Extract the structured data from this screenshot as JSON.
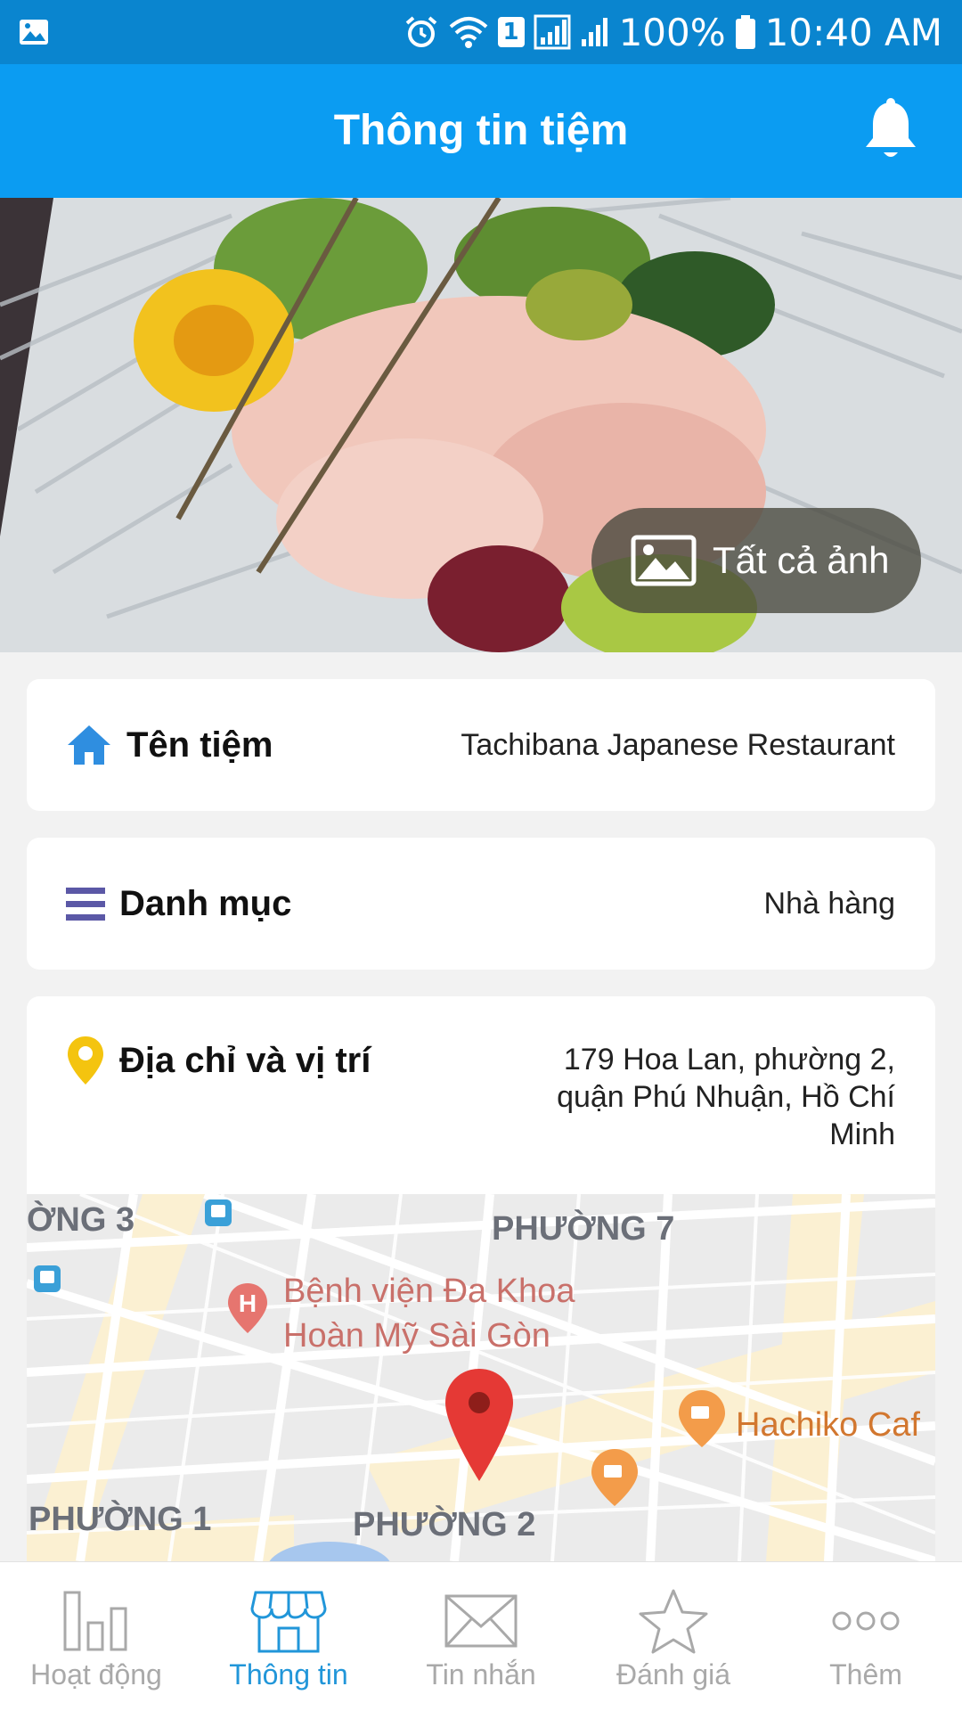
{
  "status_bar": {
    "battery": "100%",
    "time": "10:40 AM",
    "sim_badge": "1"
  },
  "header": {
    "title": "Thông tin tiệm",
    "bell_icon": "bell-icon"
  },
  "hero": {
    "all_photos_label": "Tất cả ảnh"
  },
  "info": {
    "name_label": "Tên tiệm",
    "name_value": "Tachibana Japanese Restaurant",
    "category_label": "Danh mục",
    "category_value": "Nhà hàng",
    "address_label": "Địa chỉ và vị trí",
    "address_lines": [
      "179 Hoa Lan, phường 2,",
      "quận Phú Nhuận, Hồ Chí",
      "Minh"
    ]
  },
  "map": {
    "labels": {
      "ward3": "ỜNG 3",
      "ward7": "PHƯỜNG 7",
      "ward1": "PHƯỜNG 1",
      "ward2": "PHƯỜNG 2",
      "hospital_line1": "Bệnh viện Đa Khoa",
      "hospital_line2": "Hoàn Mỹ Sài Gòn",
      "cafe": "Hachiko Caf"
    }
  },
  "bottom_nav": {
    "items": [
      {
        "label": "Hoạt động",
        "icon": "bar-chart-icon",
        "active": false
      },
      {
        "label": "Thông tin",
        "icon": "store-icon",
        "active": true
      },
      {
        "label": "Tin nhắn",
        "icon": "mail-icon",
        "active": false
      },
      {
        "label": "Đánh giá",
        "icon": "star-icon",
        "active": false
      },
      {
        "label": "Thêm",
        "icon": "more-icon",
        "active": false
      }
    ]
  },
  "colors": {
    "status_bar": "#0a85cf",
    "app_bar": "#0b9cf2",
    "active_tab": "#2196d9",
    "inactive_tab": "#a9a9a9",
    "home_icon": "#2f8ee0",
    "category_icon": "#5b58a6",
    "pin_icon": "#f4c40f",
    "map_pin": "#e53935"
  }
}
